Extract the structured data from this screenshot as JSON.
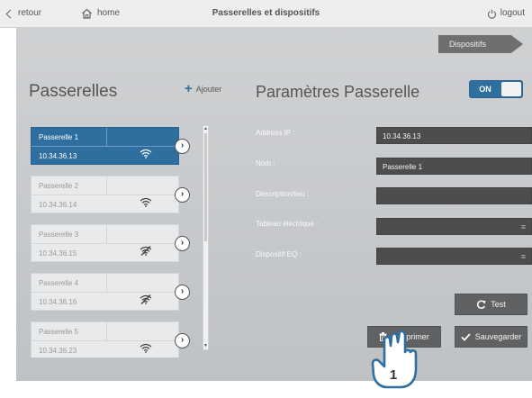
{
  "topbar": {
    "back_label": "retour",
    "home_label": "home",
    "title": "Passerelles et dispositifs",
    "logout_label": "logout"
  },
  "tab_dispositifs": "Dispositifs",
  "gateways": {
    "title": "Passerelles",
    "add_label": "Ajouter",
    "items": [
      {
        "name": "Passerelle 1",
        "ip": "10.34.36.13",
        "active": true,
        "signal": "ok"
      },
      {
        "name": "Passerelle 2",
        "ip": "10.34.36.14",
        "active": false,
        "signal": "ok"
      },
      {
        "name": "Passerelle 3",
        "ip": "10.34.36.15",
        "active": false,
        "signal": "off"
      },
      {
        "name": "Passerelle 4",
        "ip": "10.34.36.16",
        "active": false,
        "signal": "off"
      },
      {
        "name": "Passerelle 5",
        "ip": "10.34.36.23",
        "active": false,
        "signal": "ok"
      }
    ]
  },
  "params": {
    "title": "Paramètres Passerelle",
    "toggle_label": "ON",
    "fields": {
      "ip_label": "Address IP :",
      "ip_value": "10.34.36.13",
      "name_label": "Nom :",
      "name_value": "Passerelle 1",
      "desc_label": "Description/lieu :",
      "desc_value": "",
      "tableau_label": "Tableau électrique :",
      "tableau_value": "",
      "eq_label": "Dispositif EQ :",
      "eq_value": ""
    }
  },
  "buttons": {
    "test_label": "Test",
    "delete_label": "Supprimer",
    "save_label": "Sauvegarder"
  },
  "cursor_badge": "1",
  "colors": {
    "accent": "#2f6fa0",
    "field_bg": "#4d4d4d",
    "button_bg": "#5f6163",
    "panel_bg": "#c8cacc"
  }
}
